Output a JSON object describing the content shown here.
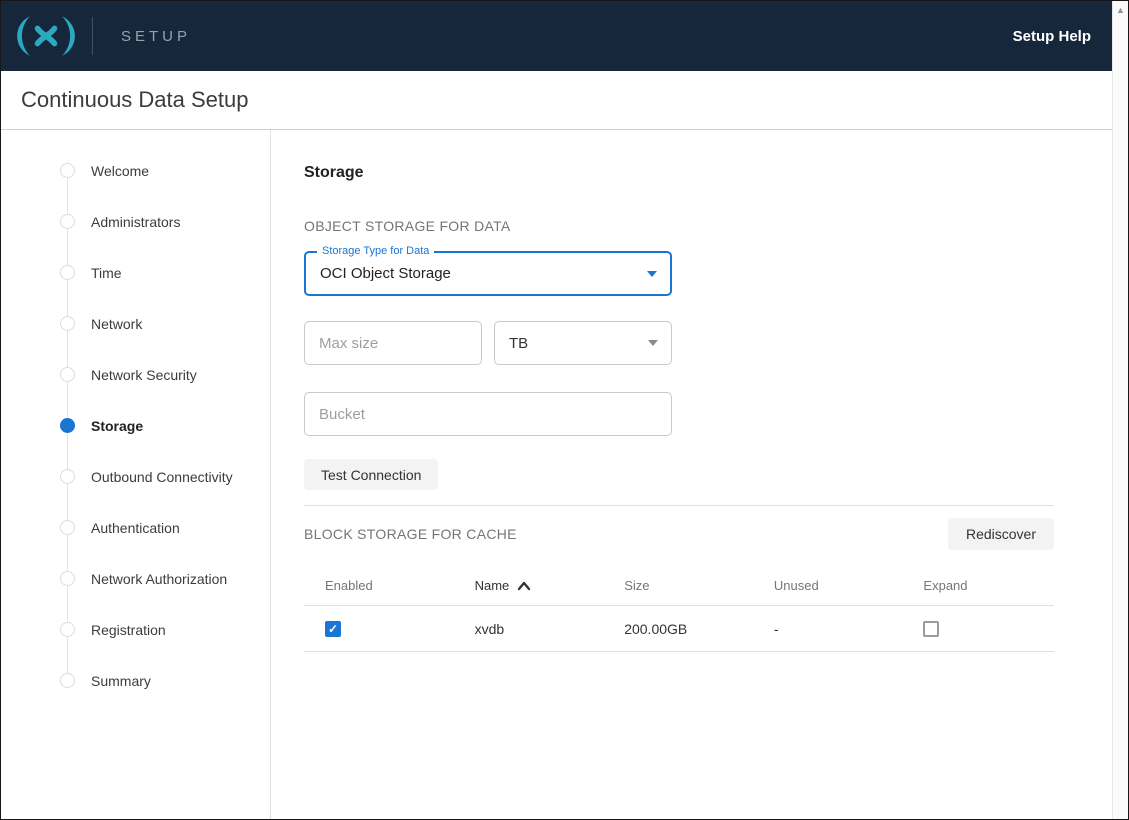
{
  "header": {
    "logo_name": "delphix-logo",
    "product": "SETUP",
    "help_label": "Setup Help",
    "bg_color": "#16273c",
    "logo_color": "#2ba9c1"
  },
  "page": {
    "title": "Continuous Data Setup"
  },
  "stepper": {
    "items": [
      {
        "label": "Welcome",
        "active": false
      },
      {
        "label": "Administrators",
        "active": false
      },
      {
        "label": "Time",
        "active": false
      },
      {
        "label": "Network",
        "active": false
      },
      {
        "label": "Network Security",
        "active": false
      },
      {
        "label": "Storage",
        "active": true
      },
      {
        "label": "Outbound Connectivity",
        "active": false
      },
      {
        "label": "Authentication",
        "active": false
      },
      {
        "label": "Network Authorization",
        "active": false
      },
      {
        "label": "Registration",
        "active": false
      },
      {
        "label": "Summary",
        "active": false
      }
    ],
    "active_color": "#1976d2"
  },
  "storage": {
    "heading": "Storage",
    "object_section": {
      "title": "OBJECT STORAGE FOR DATA",
      "storage_type": {
        "label": "Storage Type for Data",
        "value": "OCI Object Storage"
      },
      "max_size_placeholder": "Max size",
      "unit_value": "TB",
      "bucket_placeholder": "Bucket",
      "test_button": "Test Connection"
    },
    "cache_section": {
      "title": "BLOCK STORAGE FOR CACHE",
      "rediscover_button": "Rediscover",
      "table": {
        "columns": [
          "Enabled",
          "Name",
          "Size",
          "Unused",
          "Expand"
        ],
        "sort_column": "Name",
        "sort_direction": "asc",
        "rows": [
          {
            "enabled": true,
            "name": "xvdb",
            "size": "200.00GB",
            "unused": "-",
            "expand": false
          }
        ]
      }
    }
  },
  "colors": {
    "accent_blue": "#1976d2",
    "text_dark": "#333333",
    "text_muted": "#757575"
  },
  "scrollbar": {
    "up_arrow": "▲"
  }
}
